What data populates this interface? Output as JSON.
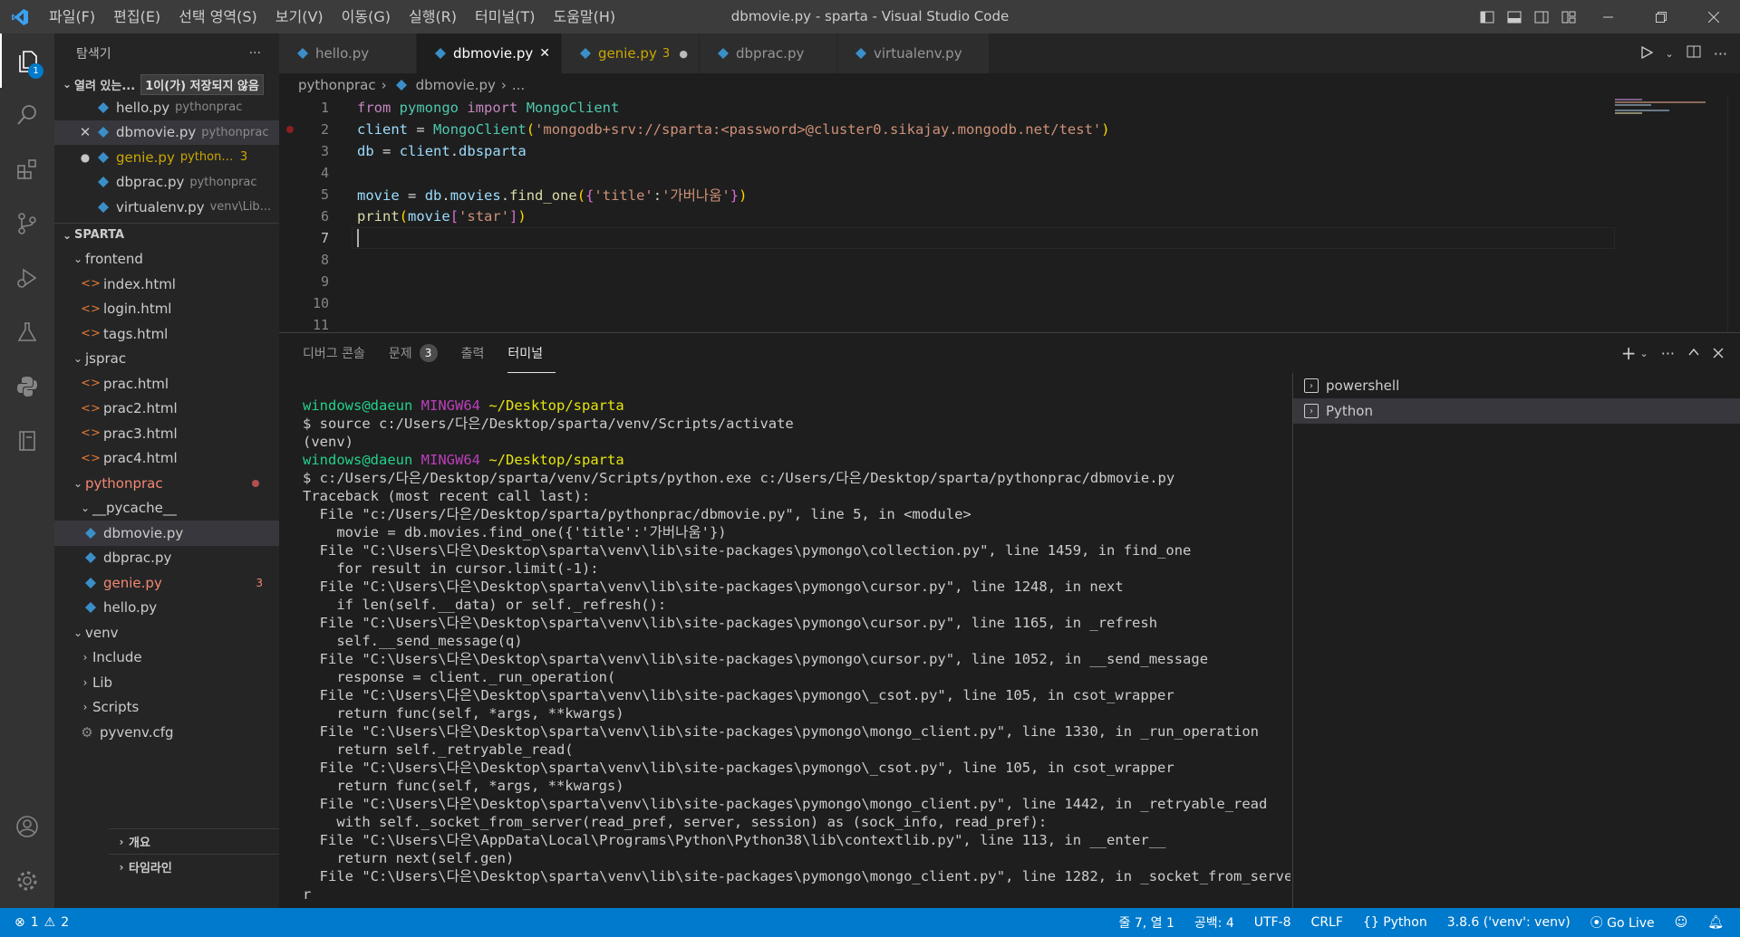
{
  "titlebar": {
    "menus": [
      "파일(F)",
      "편집(E)",
      "선택 영역(S)",
      "보기(V)",
      "이동(G)",
      "실행(R)",
      "터미널(T)",
      "도움말(H)"
    ],
    "title": "dbmovie.py - sparta - Visual Studio Code"
  },
  "activity": {
    "explorer_badge": "1"
  },
  "sidebar": {
    "header": "탐색기",
    "more": "···",
    "open_editors": {
      "label": "열려 있는...",
      "unsaved_tag": "1이(가) 저장되지 않음",
      "items": [
        {
          "name": "hello.py",
          "desc": "pythonprac"
        },
        {
          "name": "dbmovie.py",
          "desc": "pythonprac"
        },
        {
          "name": "genie.py",
          "desc": "pythonp...",
          "count": "3"
        },
        {
          "name": "dbprac.py",
          "desc": "pythonprac"
        },
        {
          "name": "virtualenv.py",
          "desc": "venv\\Lib..."
        }
      ]
    },
    "workspace": "SPARTA",
    "tree": {
      "frontend": "frontend",
      "frontend_files": [
        "index.html",
        "login.html",
        "tags.html"
      ],
      "jsprac": "jsprac",
      "jsprac_files": [
        "prac.html",
        "prac2.html",
        "prac3.html",
        "prac4.html"
      ],
      "pythonprac": "pythonprac",
      "pycache": "__pycache__",
      "pythonprac_files": [
        "dbmovie.py",
        "dbprac.py",
        "genie.py",
        "hello.py"
      ],
      "genie_count": "3",
      "venv": "venv",
      "venv_folders": [
        "Include",
        "Lib",
        "Scripts"
      ],
      "pyvenv": "pyvenv.cfg"
    },
    "outline": "개요",
    "timeline": "타임라인"
  },
  "tabs": [
    {
      "label": "hello.py"
    },
    {
      "label": "dbmovie.py",
      "close": "✕"
    },
    {
      "label": "genie.py",
      "count": "3"
    },
    {
      "label": "dbprac.py"
    },
    {
      "label": "virtualenv.py"
    }
  ],
  "breadcrumb": {
    "folder": "pythonprac",
    "file": "dbmovie.py",
    "more": "..."
  },
  "editor": {
    "line_numbers": [
      "1",
      "2",
      "3",
      "4",
      "5",
      "6",
      "7",
      "8",
      "9",
      "10",
      "11"
    ],
    "current_line": 7
  },
  "panel": {
    "tabs": [
      {
        "label": "디버그 콘솔"
      },
      {
        "label": "문제",
        "count": "3"
      },
      {
        "label": "출력"
      },
      {
        "label": "터미널"
      }
    ],
    "terminals": [
      "powershell",
      "Python"
    ],
    "output": [
      {
        "type": "prompt",
        "user": "windows@daeun",
        "env": "MINGW64",
        "path": "~/Desktop/sparta"
      },
      {
        "type": "text",
        "text": "$ source c:/Users/다은/Desktop/sparta/venv/Scripts/activate"
      },
      {
        "type": "text",
        "text": "(venv)"
      },
      {
        "type": "prompt",
        "user": "windows@daeun",
        "env": "MINGW64",
        "path": "~/Desktop/sparta"
      },
      {
        "type": "text",
        "text": "$ c:/Users/다은/Desktop/sparta/venv/Scripts/python.exe c:/Users/다은/Desktop/sparta/pythonprac/dbmovie.py"
      },
      {
        "type": "text",
        "text": "Traceback (most recent call last):"
      },
      {
        "type": "text",
        "text": "  File \"c:/Users/다은/Desktop/sparta/pythonprac/dbmovie.py\", line 5, in <module>"
      },
      {
        "type": "text",
        "text": "    movie = db.movies.find_one({'title':'가버나움'})"
      },
      {
        "type": "text",
        "text": "  File \"C:\\Users\\다은\\Desktop\\sparta\\venv\\lib\\site-packages\\pymongo\\collection.py\", line 1459, in find_one"
      },
      {
        "type": "text",
        "text": "    for result in cursor.limit(-1):"
      },
      {
        "type": "text",
        "text": "  File \"C:\\Users\\다은\\Desktop\\sparta\\venv\\lib\\site-packages\\pymongo\\cursor.py\", line 1248, in next"
      },
      {
        "type": "text",
        "text": "    if len(self.__data) or self._refresh():"
      },
      {
        "type": "text",
        "text": "  File \"C:\\Users\\다은\\Desktop\\sparta\\venv\\lib\\site-packages\\pymongo\\cursor.py\", line 1165, in _refresh"
      },
      {
        "type": "text",
        "text": "    self.__send_message(q)"
      },
      {
        "type": "text",
        "text": "  File \"C:\\Users\\다은\\Desktop\\sparta\\venv\\lib\\site-packages\\pymongo\\cursor.py\", line 1052, in __send_message"
      },
      {
        "type": "text",
        "text": "    response = client._run_operation("
      },
      {
        "type": "text",
        "text": "  File \"C:\\Users\\다은\\Desktop\\sparta\\venv\\lib\\site-packages\\pymongo\\_csot.py\", line 105, in csot_wrapper"
      },
      {
        "type": "text",
        "text": "    return func(self, *args, **kwargs)"
      },
      {
        "type": "text",
        "text": "  File \"C:\\Users\\다은\\Desktop\\sparta\\venv\\lib\\site-packages\\pymongo\\mongo_client.py\", line 1330, in _run_operation"
      },
      {
        "type": "text",
        "text": "    return self._retryable_read("
      },
      {
        "type": "text",
        "text": "  File \"C:\\Users\\다은\\Desktop\\sparta\\venv\\lib\\site-packages\\pymongo\\_csot.py\", line 105, in csot_wrapper"
      },
      {
        "type": "text",
        "text": "    return func(self, *args, **kwargs)"
      },
      {
        "type": "text",
        "text": "  File \"C:\\Users\\다은\\Desktop\\sparta\\venv\\lib\\site-packages\\pymongo\\mongo_client.py\", line 1442, in _retryable_read"
      },
      {
        "type": "text",
        "text": "    with self._socket_from_server(read_pref, server, session) as (sock_info, read_pref):"
      },
      {
        "type": "text",
        "text": "  File \"C:\\Users\\다은\\AppData\\Local\\Programs\\Python\\Python38\\lib\\contextlib.py\", line 113, in __enter__"
      },
      {
        "type": "text",
        "text": "    return next(self.gen)"
      },
      {
        "type": "text",
        "text": "  File \"C:\\Users\\다은\\Desktop\\sparta\\venv\\lib\\site-packages\\pymongo\\mongo_client.py\", line 1282, in _socket_from_serve"
      },
      {
        "type": "text",
        "text": "r"
      }
    ]
  },
  "statusbar": {
    "errors": "1",
    "warnings": "2",
    "position": "줄 7, 열 1",
    "spaces": "공백: 4",
    "encoding": "UTF-8",
    "eol": "CRLF",
    "language": "Python",
    "interpreter": "3.8.6 ('venv': venv)",
    "golive": "Go Live"
  },
  "colors": {
    "accent": "#007acc",
    "modified": "#cca700",
    "error": "#f48771"
  }
}
